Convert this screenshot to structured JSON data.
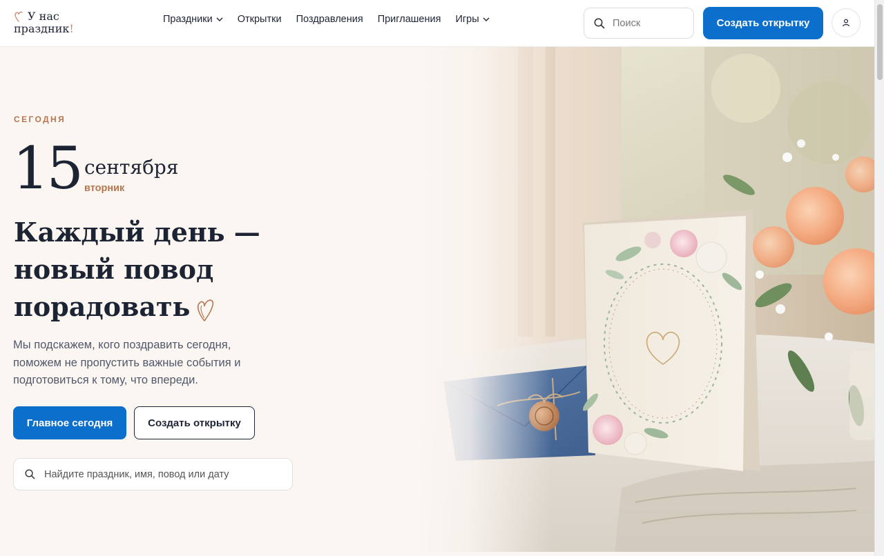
{
  "brand": {
    "logo_line1": "У нас",
    "logo_line2": "праздник",
    "logo_excl": "!",
    "accent_color": "#c8876b"
  },
  "nav": {
    "items": [
      {
        "label": "Праздники",
        "has_dropdown": true
      },
      {
        "label": "Открытки",
        "has_dropdown": false
      },
      {
        "label": "Поздравления",
        "has_dropdown": false
      },
      {
        "label": "Приглашения",
        "has_dropdown": false
      },
      {
        "label": "Игры",
        "has_dropdown": true
      }
    ]
  },
  "header": {
    "search_placeholder": "Поиск",
    "create_button": "Создать открытку",
    "user_icon": "user-icon"
  },
  "hero": {
    "eyebrow": "СЕГОДНЯ",
    "day": "15",
    "month": "сентября",
    "weekday": "вторник",
    "headline_line1": "Каждый день —",
    "headline_line2": "новый повод",
    "headline_line3": "порадовать",
    "lead": "Мы подскажем, кого поздравить сегодня, поможем не пропустить важные события и подготовиться к тому, что впереди.",
    "primary_button": "Главное сегодня",
    "secondary_button": "Создать открытку",
    "search_placeholder": "Найдите праздник, имя, повод или дату"
  },
  "colors": {
    "primary": "#0d6fcc",
    "accent": "#b5764f",
    "text": "#1c2434",
    "background": "#fbf6f2"
  }
}
